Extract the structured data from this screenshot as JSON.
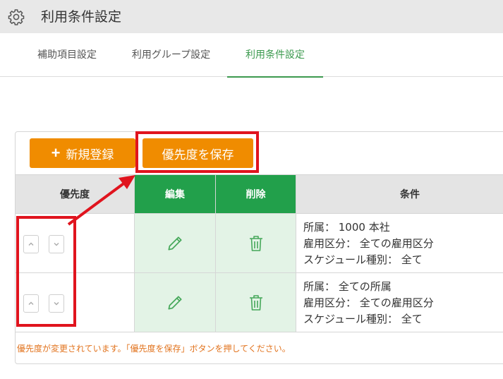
{
  "header": {
    "title": "利用条件設定",
    "icon": "gear-icon"
  },
  "tabs": [
    {
      "label": "補助項目設定"
    },
    {
      "label": "利用グループ設定"
    },
    {
      "label": "利用条件設定",
      "active": true
    }
  ],
  "toolbar": {
    "new_label": "新規登録",
    "save_label": "優先度を保存"
  },
  "table": {
    "headers": {
      "priority": "優先度",
      "edit": "編集",
      "delete": "削除",
      "condition": "条件"
    },
    "rows": [
      {
        "conditions": [
          "所属： 1000 本社",
          "雇用区分： 全ての雇用区分",
          "スケジュール種別： 全て"
        ]
      },
      {
        "conditions": [
          "所属： 全ての所属",
          "雇用区分： 全ての雇用区分",
          "スケジュール種別： 全て"
        ]
      }
    ]
  },
  "notice": "優先度が変更されています。「優先度を保存」ボタンを押してください。",
  "colors": {
    "accent_orange": "#f08c00",
    "header_green": "#22a04b",
    "annotation_red": "#e0141e",
    "active_tab": "#3c9a4f"
  }
}
